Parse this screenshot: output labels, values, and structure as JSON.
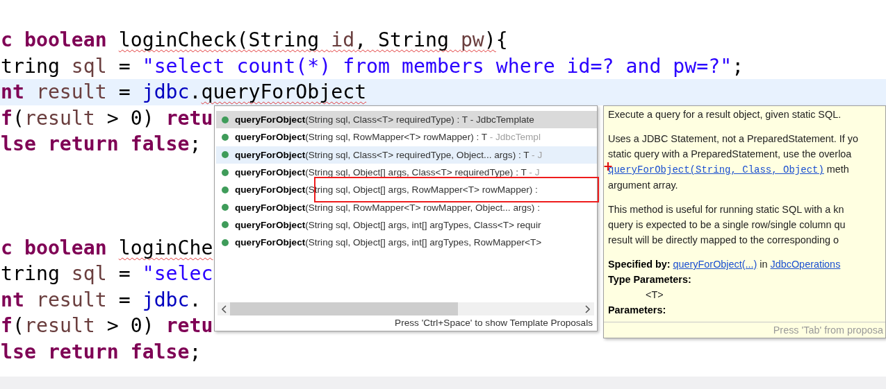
{
  "editor": {
    "blocks": [
      {
        "lines": [
          {
            "current": false,
            "tokens": [
              {
                "kind": "keyword",
                "text": "c "
              },
              {
                "kind": "keyword",
                "text": "boolean "
              },
              {
                "kind": "plain",
                "text": "loginCheck(String ",
                "error": true
              },
              {
                "kind": "var",
                "text": "id",
                "error": true
              },
              {
                "kind": "plain",
                "text": ", String ",
                "error": true
              },
              {
                "kind": "var",
                "text": "pw",
                "error": true
              },
              {
                "kind": "plain",
                "text": ")",
                "error": true
              },
              {
                "kind": "plain",
                "text": "{"
              }
            ]
          },
          {
            "current": false,
            "tokens": [
              {
                "kind": "plain",
                "text": "tring "
              },
              {
                "kind": "var",
                "text": "sql"
              },
              {
                "kind": "plain",
                "text": " = "
              },
              {
                "kind": "string",
                "text": "\"select count(*) from members where id=? and pw=?\""
              },
              {
                "kind": "plain",
                "text": ";"
              }
            ]
          },
          {
            "current": true,
            "tokens": [
              {
                "kind": "keyword",
                "text": "nt "
              },
              {
                "kind": "var",
                "text": "result"
              },
              {
                "kind": "plain",
                "text": " = "
              },
              {
                "kind": "field",
                "text": "jdbc"
              },
              {
                "kind": "plain",
                "text": "."
              },
              {
                "kind": "plain",
                "text": "queryForObject",
                "error": true
              }
            ]
          },
          {
            "current": false,
            "tokens": [
              {
                "kind": "keyword",
                "text": "f"
              },
              {
                "kind": "plain",
                "text": "("
              },
              {
                "kind": "var",
                "text": "result"
              },
              {
                "kind": "plain",
                "text": " > 0) "
              },
              {
                "kind": "keyword",
                "text": "retu"
              }
            ]
          },
          {
            "current": false,
            "tokens": [
              {
                "kind": "keyword",
                "text": "lse return false"
              },
              {
                "kind": "plain",
                "text": ";"
              }
            ]
          }
        ]
      },
      {
        "lines": [
          {
            "current": false,
            "tokens": [
              {
                "kind": "keyword",
                "text": "c "
              },
              {
                "kind": "keyword",
                "text": "boolean "
              },
              {
                "kind": "plain",
                "text": "loginChe",
                "error": true
              }
            ]
          },
          {
            "current": false,
            "tokens": [
              {
                "kind": "plain",
                "text": "tring "
              },
              {
                "kind": "var",
                "text": "sql"
              },
              {
                "kind": "plain",
                "text": " = "
              },
              {
                "kind": "string",
                "text": "\"selec"
              }
            ]
          },
          {
            "current": false,
            "tokens": [
              {
                "kind": "keyword",
                "text": "nt "
              },
              {
                "kind": "var",
                "text": "result"
              },
              {
                "kind": "plain",
                "text": " = "
              },
              {
                "kind": "field",
                "text": "jdbc"
              },
              {
                "kind": "plain",
                "text": "."
              }
            ]
          },
          {
            "current": false,
            "tokens": [
              {
                "kind": "keyword",
                "text": "f"
              },
              {
                "kind": "plain",
                "text": "("
              },
              {
                "kind": "var",
                "text": "result"
              },
              {
                "kind": "plain",
                "text": " > 0) "
              },
              {
                "kind": "keyword",
                "text": "retu"
              }
            ]
          },
          {
            "current": false,
            "tokens": [
              {
                "kind": "keyword",
                "text": "lse return false"
              },
              {
                "kind": "plain",
                "text": ";"
              }
            ]
          }
        ]
      }
    ]
  },
  "proposals": {
    "items": [
      {
        "name": "queryForObject",
        "signature": "(String sql, Class<T> requiredType) : T ",
        "owner": "- JdbcTemplate",
        "selected": true,
        "highlighted": false,
        "marked": false
      },
      {
        "name": "queryForObject",
        "signature": "(String sql, RowMapper<T> rowMapper) : T ",
        "owner": "- JdbcTempl",
        "selected": false,
        "highlighted": false,
        "marked": false
      },
      {
        "name": "queryForObject",
        "signature": "(String sql, Class<T> requiredType, Object... args) : T ",
        "owner": "- J",
        "selected": false,
        "highlighted": true,
        "marked": false
      },
      {
        "name": "queryForObject",
        "signature": "(String sql, Object[] args, Class<T> requiredType) : T ",
        "owner": "- J",
        "selected": false,
        "highlighted": false,
        "marked": false
      },
      {
        "name": "queryForObject",
        "signature": "(String sql, Object[] args, RowMapper<T> rowMapper) :",
        "selected": false,
        "highlighted": false,
        "marked": true
      },
      {
        "name": "queryForObject",
        "signature": "(String sql, RowMapper<T> rowMapper, Object... args) :",
        "selected": false,
        "highlighted": false,
        "marked": false
      },
      {
        "name": "queryForObject",
        "signature": "(String sql, Object[] args, int[] argTypes, Class<T> requir",
        "selected": false,
        "highlighted": false,
        "marked": false
      },
      {
        "name": "queryForObject",
        "signature": "(String sql, Object[] args, int[] argTypes, RowMapper<T>",
        "selected": false,
        "highlighted": false,
        "marked": false
      }
    ],
    "footer": "Press 'Ctrl+Space' to show Template Proposals"
  },
  "doc": {
    "sections": [
      [
        {
          "lines": [
            [
              {
                "kind": "plain",
                "text": "Execute a query for a result object, given static SQL."
              }
            ]
          ]
        }
      ],
      [
        {
          "lines": [
            [
              {
                "kind": "plain",
                "text": "Uses a JDBC Statement, not a PreparedStatement. If yo"
              }
            ],
            [
              {
                "kind": "plain",
                "text": "static query with a PreparedStatement, use the overloa"
              }
            ],
            [
              {
                "kind": "code-link",
                "text": "queryForObject(String, Class, Object)"
              },
              {
                "kind": "plain",
                "text": " meth"
              }
            ],
            [
              {
                "kind": "plain",
                "text": "argument array."
              }
            ]
          ]
        }
      ],
      [
        {
          "lines": [
            [
              {
                "kind": "plain",
                "text": "This method is useful for running static SQL with a kn"
              }
            ],
            [
              {
                "kind": "plain",
                "text": "query is expected to be a single row/single column qu"
              }
            ],
            [
              {
                "kind": "plain",
                "text": "result will be directly mapped to the corresponding o"
              }
            ]
          ]
        }
      ],
      [
        {
          "lines": [
            [
              {
                "kind": "bold",
                "text": "Specified by: "
              },
              {
                "kind": "link",
                "text": "queryForObject(...)"
              },
              {
                "kind": "plain",
                "text": " in "
              },
              {
                "kind": "link",
                "text": "JdbcOperations"
              }
            ]
          ]
        },
        {
          "lines": [
            [
              {
                "kind": "bold",
                "text": "Type Parameters:"
              }
            ]
          ]
        },
        {
          "indented": true,
          "lines": [
            [
              {
                "kind": "plain",
                "text": "<T>"
              }
            ]
          ]
        },
        {
          "lines": [
            [
              {
                "kind": "bold",
                "text": "Parameters:"
              }
            ]
          ]
        }
      ]
    ],
    "footer": "Press 'Tab' from proposa"
  }
}
